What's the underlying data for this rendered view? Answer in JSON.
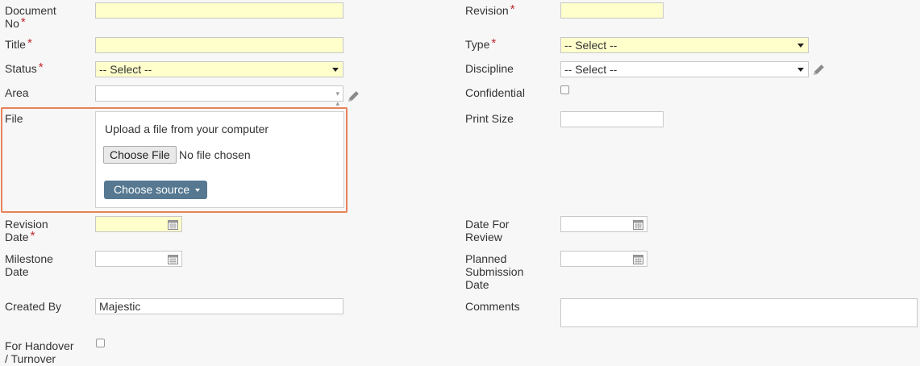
{
  "colors": {
    "required": "#c0272d",
    "required_bg": "#ffffcc",
    "highlight_border": "#e8825a",
    "source_button": "#567891"
  },
  "required_marker": "*",
  "fields": {
    "document_no": {
      "label_line1": "Document",
      "label_line2": "No",
      "value": ""
    },
    "title": {
      "label": "Title",
      "value": ""
    },
    "status": {
      "label": "Status",
      "selected": "-- Select --"
    },
    "area": {
      "label": "Area",
      "value": ""
    },
    "file": {
      "label": "File",
      "upload_text": "Upload a file from your computer",
      "choose_file": "Choose File",
      "no_file": "No file chosen",
      "choose_source": "Choose source"
    },
    "revision_date": {
      "label_line1": "Revision",
      "label_line2": "Date"
    },
    "milestone_date": {
      "label_line1": "Milestone",
      "label_line2": "Date"
    },
    "created_by": {
      "label": "Created By",
      "value": "Majestic"
    },
    "handover": {
      "label_line1": "For Handover",
      "label_line2": "/ Turnover",
      "checked": false
    },
    "revision": {
      "label": "Revision",
      "value": ""
    },
    "type": {
      "label": "Type",
      "selected": "-- Select --"
    },
    "discipline": {
      "label": "Discipline",
      "selected": "-- Select --"
    },
    "confidential": {
      "label": "Confidential",
      "checked": false
    },
    "print_size": {
      "label": "Print Size",
      "value": ""
    },
    "date_for_review": {
      "label_line1": "Date For",
      "label_line2": "Review"
    },
    "planned_submission_date": {
      "label_line1": "Planned",
      "label_line2": "Submission",
      "label_line3": "Date"
    },
    "comments": {
      "label": "Comments",
      "value": ""
    }
  },
  "icons": {
    "calendar": "calendar-icon",
    "pencil": "pencil-icon",
    "dropdown": "chevron-down-icon"
  }
}
